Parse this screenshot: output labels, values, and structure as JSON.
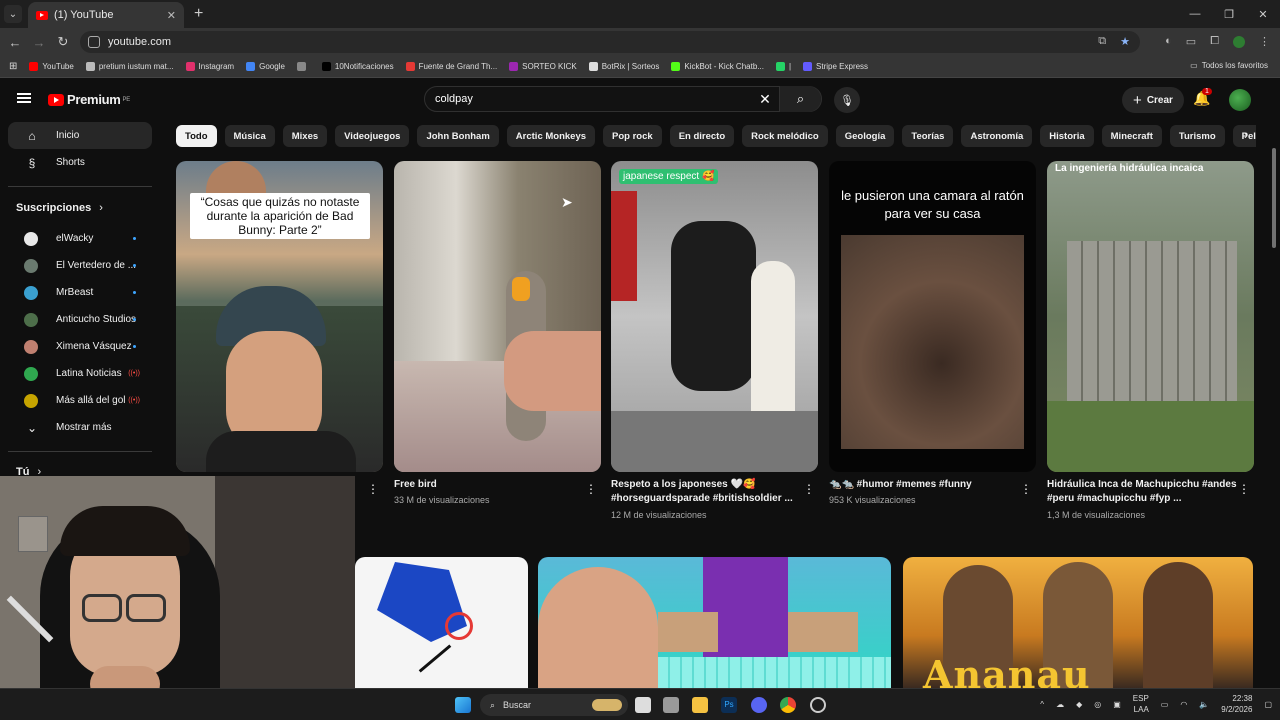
{
  "browser": {
    "tab_title": "(1) YouTube",
    "url": "youtube.com",
    "new_tab": "+",
    "bookmarks": [
      {
        "label": "YouTube",
        "color": "#ff0000"
      },
      {
        "label": "pretium iustum mat...",
        "color": "#bbbbbb"
      },
      {
        "label": "Instagram",
        "color": "#e1306c"
      },
      {
        "label": "Google",
        "color": "#4285f4"
      },
      {
        "label": "",
        "color": "#888888"
      },
      {
        "label": "10Notificaciones",
        "color": "#000000"
      },
      {
        "label": "Fuente de Grand Th...",
        "color": "#e53935"
      },
      {
        "label": "SORTEO KICK",
        "color": "#9c27b0"
      },
      {
        "label": "BotRix | Sorteos",
        "color": "#dddddd"
      },
      {
        "label": "KickBot - Kick Chatb...",
        "color": "#53fc18"
      },
      {
        "label": "|",
        "color": "#25d366"
      },
      {
        "label": "Stripe Express",
        "color": "#635bff"
      }
    ],
    "all_bookmarks": "Todos los favoritos"
  },
  "header": {
    "logo": "Premium",
    "logo_region": "PE",
    "search_value": "coldpay",
    "create": "Crear",
    "notification_count": "1"
  },
  "sidebar": {
    "items": [
      {
        "label": "Inicio",
        "icon": "⌂"
      },
      {
        "label": "Shorts",
        "icon": "§"
      }
    ],
    "subs_heading": "Suscripciones",
    "subscriptions": [
      {
        "label": "elWacky",
        "color": "#e8e8e8",
        "status": "dot"
      },
      {
        "label": "El Vertedero de ...",
        "color": "#6a7a6f",
        "status": "dot"
      },
      {
        "label": "MrBeast",
        "color": "#3aa0d0",
        "status": "dot"
      },
      {
        "label": "Anticucho Studios",
        "color": "#4d6e4a",
        "status": "dot"
      },
      {
        "label": "Ximena Vásquez",
        "color": "#c08070",
        "status": "dot"
      },
      {
        "label": "Latina Noticias",
        "color": "#2fa84f",
        "status": "live"
      },
      {
        "label": "Más allá del gol",
        "color": "#c6a400",
        "status": "live"
      }
    ],
    "show_more": "Mostrar más",
    "you_heading": "Tú"
  },
  "chips": [
    "Todo",
    "Música",
    "Mixes",
    "Videojuegos",
    "John Bonham",
    "Arctic Monkeys",
    "Pop rock",
    "En directo",
    "Rock melódico",
    "Geología",
    "Teorías",
    "Astronomía",
    "Historia",
    "Minecraft",
    "Turismo",
    "Películas de comedia"
  ],
  "shorts": [
    {
      "title": "",
      "views": "",
      "caption": "“Cosas que quizás no notaste durante la aparición de Bad Bunny: Parte 2”"
    },
    {
      "title": "Free bird",
      "views": "33 M de visualizaciones"
    },
    {
      "title": "Respeto a los japoneses 🤍🥰 #horseguardsparade #britishsoldier ...",
      "views": "12 M de visualizaciones",
      "caption": "japanese respect 🥰"
    },
    {
      "title": "🐀🐀 #humor #memes #funny",
      "views": "953 K visualizaciones",
      "caption": "le pusieron una camara al ratón para ver su casa"
    },
    {
      "title": "Hidráulica  Inca de Machupicchu #andes #peru #machupicchu #fyp ...",
      "views": "1,3 M de visualizaciones",
      "caption": "La ingeniería hidráulica incaica"
    }
  ],
  "videos": [
    {
      "caption": ""
    },
    {
      "caption": ""
    },
    {
      "caption": "Ananau"
    }
  ],
  "taskbar": {
    "search": "Buscar",
    "lang": "ESP",
    "lang2": "LAA",
    "time": "22:38",
    "date": "9/2/2026"
  }
}
